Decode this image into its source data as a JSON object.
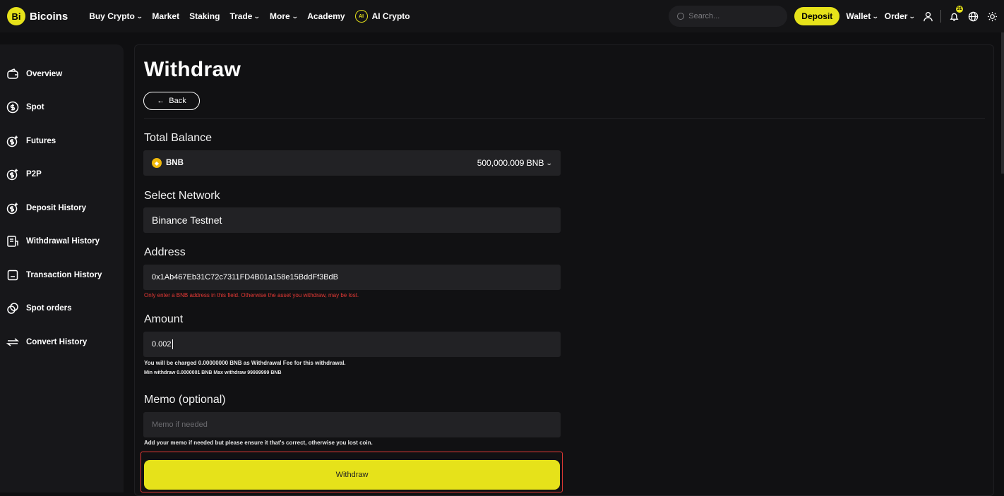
{
  "brand": {
    "logo_glyph": "Bi",
    "name": "Bicoins"
  },
  "nav": [
    {
      "label": "Buy Crypto",
      "dropdown": true
    },
    {
      "label": "Market",
      "dropdown": false
    },
    {
      "label": "Staking",
      "dropdown": false
    },
    {
      "label": "Trade",
      "dropdown": true
    },
    {
      "label": "More",
      "dropdown": true
    },
    {
      "label": "Academy",
      "dropdown": false
    },
    {
      "label": "AI Crypto",
      "dropdown": false
    }
  ],
  "header": {
    "search_placeholder": "Search...",
    "deposit_label": "Deposit",
    "wallet_label": "Wallet",
    "order_label": "Order",
    "notification_count": "31"
  },
  "sidebar": {
    "items": [
      {
        "label": "Overview",
        "icon": "wallet-icon"
      },
      {
        "label": "Spot",
        "icon": "dollar-icon"
      },
      {
        "label": "Futures",
        "icon": "coin-icon"
      },
      {
        "label": "P2P",
        "icon": "coin-icon"
      },
      {
        "label": "Deposit History",
        "icon": "coin-icon"
      },
      {
        "label": "Withdrawal History",
        "icon": "document-icon"
      },
      {
        "label": "Transaction History",
        "icon": "receipt-icon"
      },
      {
        "label": "Spot orders",
        "icon": "link-icon"
      },
      {
        "label": "Convert History",
        "icon": "swap-icon"
      }
    ]
  },
  "page": {
    "title": "Withdraw",
    "back_label": "Back",
    "total_balance_label": "Total Balance",
    "coin_symbol": "BNB",
    "balance_value": "500,000.009 BNB",
    "network_label": "Select Network",
    "network_value": "Binance Testnet",
    "address_label": "Address",
    "address_value": "0x1Ab467Eb31C72c7311FD4B01a158e15BddFf3BdB",
    "address_warning": "Only enter a BNB address in this field. Otherwise the asset you withdraw, may be lost.",
    "amount_label": "Amount",
    "amount_value": "0.002",
    "fee_note": "You will be charged 0.00000000 BNB as Withdrawal Fee for this withdrawal.",
    "limits_note": "Min withdraw 0.0000001 BNB   Max withdraw 99999999 BNB",
    "memo_label": "Memo (optional)",
    "memo_placeholder": "Memo if needed",
    "memo_note": "Add your memo if needed but please ensure it that's correct, otherwise you lost coin.",
    "withdraw_button": "Withdraw"
  },
  "colors": {
    "accent": "#e6e21a",
    "error": "#e53935",
    "background": "#0f0f11"
  }
}
